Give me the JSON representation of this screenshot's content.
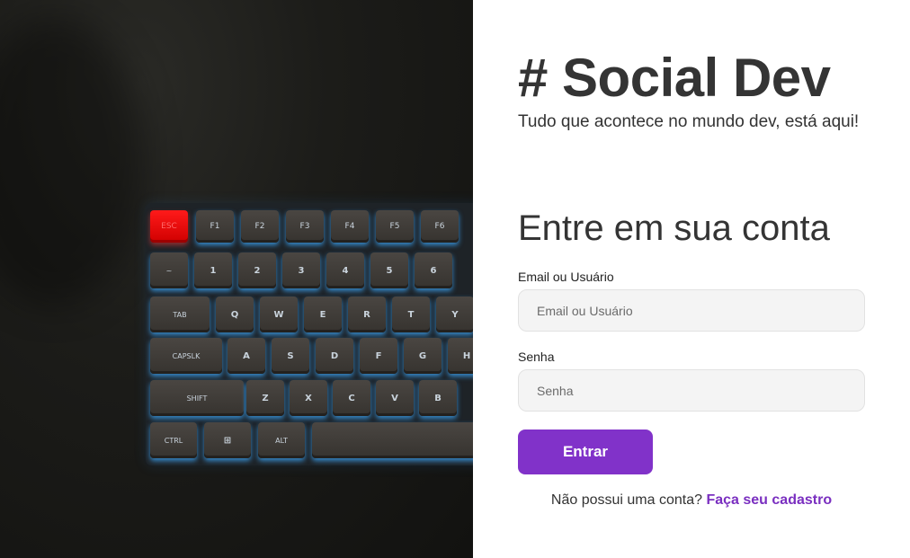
{
  "brand": {
    "title": "# Social Dev",
    "tagline": "Tudo que acontece no mundo dev, está aqui!"
  },
  "login_form": {
    "heading": "Entre em sua conta",
    "email_label": "Email ou Usuário",
    "email_placeholder": "Email ou Usuário",
    "password_label": "Senha",
    "password_placeholder": "Senha",
    "submit_label": "Entrar",
    "signup_prompt": "Não possui uma conta?",
    "signup_link": "Faça seu cadastro"
  },
  "keyboard_keys": {
    "esc": "ESC",
    "f1": "F1",
    "f2": "F2",
    "f3": "F3",
    "f4": "F4",
    "f5": "F5",
    "f6": "F6",
    "tilde": "~",
    "n1": "1",
    "n2": "2",
    "n3": "3",
    "n4": "4",
    "n5": "5",
    "n6": "6",
    "tab": "TAB",
    "q": "Q",
    "w": "W",
    "e": "E",
    "r": "R",
    "t": "T",
    "y": "Y",
    "caps": "CAPSLK",
    "a": "A",
    "s": "S",
    "d": "D",
    "f": "F",
    "g": "G",
    "h": "H",
    "shift": "SHIFT",
    "z": "Z",
    "x": "X",
    "c": "C",
    "v": "V",
    "b": "B",
    "ctrl": "CTRL",
    "win": "⊞",
    "alt": "ALT"
  },
  "colors": {
    "accent": "#8132c9",
    "link": "#7a2fc0",
    "input_bg": "#f4f4f4",
    "esc_key": "#ff1a1a",
    "backlight": "#3caaff"
  }
}
